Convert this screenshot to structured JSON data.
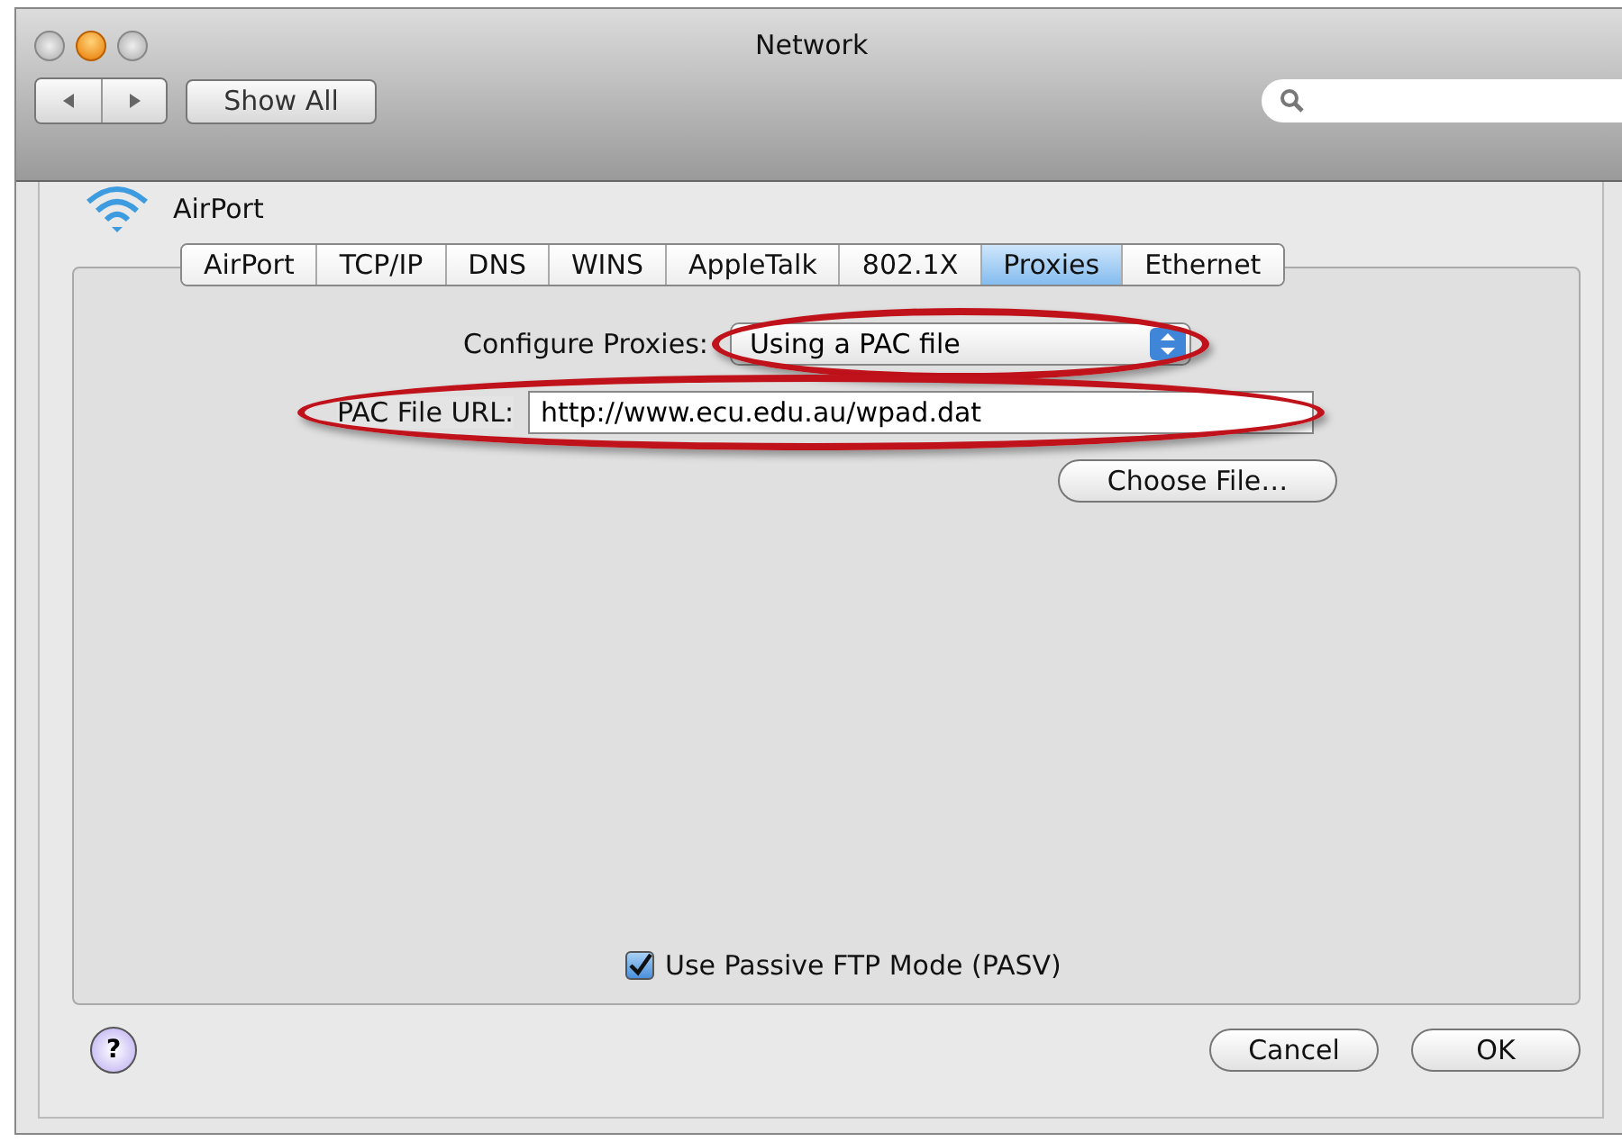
{
  "window": {
    "title": "Network"
  },
  "toolbar": {
    "show_all": "Show All"
  },
  "service": {
    "name": "AirPort"
  },
  "tabs": [
    {
      "label": "AirPort",
      "selected": false
    },
    {
      "label": "TCP/IP",
      "selected": false
    },
    {
      "label": "DNS",
      "selected": false
    },
    {
      "label": "WINS",
      "selected": false
    },
    {
      "label": "AppleTalk",
      "selected": false
    },
    {
      "label": "802.1X",
      "selected": false
    },
    {
      "label": "Proxies",
      "selected": true
    },
    {
      "label": "Ethernet",
      "selected": false
    }
  ],
  "configure_proxies": {
    "label": "Configure Proxies:",
    "value": "Using a PAC file",
    "highlighted": true
  },
  "pac_url": {
    "label": "PAC File URL:",
    "value": "http://www.ecu.edu.au/wpad.dat",
    "highlighted": true
  },
  "choose_file": "Choose File…",
  "passive_ftp": {
    "label": "Use Passive FTP Mode (PASV)",
    "checked": true
  },
  "help": "?",
  "buttons": [
    {
      "label": "Cancel"
    },
    {
      "label": "OK"
    }
  ]
}
